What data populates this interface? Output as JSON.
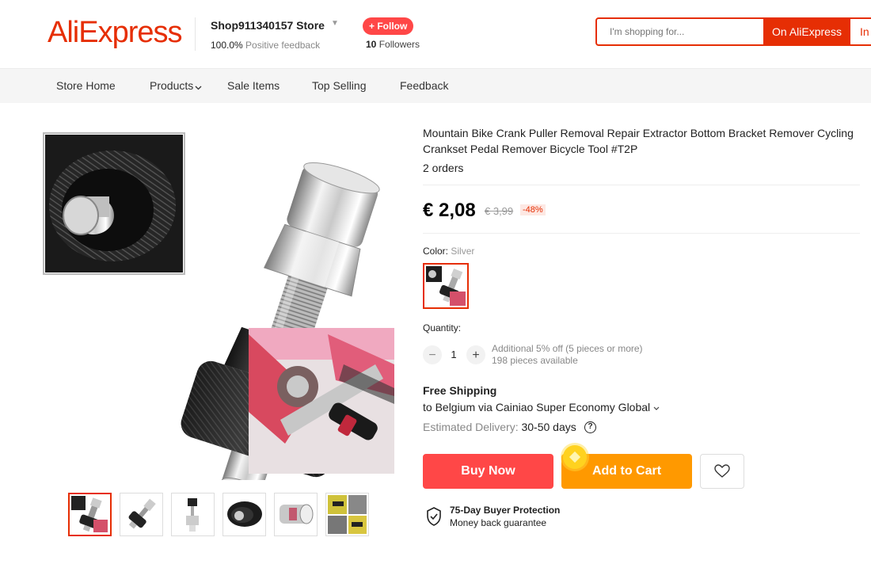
{
  "header": {
    "logo_text": "AliExpress",
    "store_name": "Shop911340157 Store",
    "feedback_percent": "100.0%",
    "feedback_label": "Positive feedback",
    "follow_label": "+ Follow",
    "followers_count": "10",
    "followers_label": "Followers",
    "search_placeholder": "I'm shopping for...",
    "search_button": "On AliExpress",
    "search_button2": "In"
  },
  "nav": {
    "items": [
      "Store Home",
      "Products",
      "Sale Items",
      "Top Selling",
      "Feedback"
    ]
  },
  "gallery": {
    "main_image_icon": "crank-puller-tool-image",
    "thumbnails": [
      "thumb-1",
      "thumb-2",
      "thumb-3",
      "thumb-4",
      "thumb-5",
      "thumb-6"
    ]
  },
  "product": {
    "title": "Mountain Bike Crank Puller Removal Repair Extractor Bottom Bracket Remover Cycling Crankset Pedal Remover Bicycle Tool #T2P",
    "orders": "2 orders",
    "price": "€ 2,08",
    "original_price": "€ 3,99",
    "discount": "-48%",
    "color_label": "Color:",
    "color_value": "Silver",
    "quantity_label": "Quantity:",
    "quantity_value": "1",
    "minus": "−",
    "plus": "+",
    "qty_note_1": "Additional 5% off (5 pieces or more)",
    "qty_note_2": "198 pieces available",
    "shipping_title": "Free Shipping",
    "shipping_line": "to Belgium via Cainiao Super Economy Global",
    "delivery_label": "Estimated Delivery:",
    "delivery_value": "30-50 days",
    "help": "?",
    "buy_now": "Buy Now",
    "add_to_cart": "Add to Cart",
    "protection_title": "75-Day Buyer Protection",
    "protection_sub": "Money back guarantee"
  },
  "colors": {
    "brand": "#e62e04",
    "buy": "#ff4747",
    "cart": "#ff9900"
  }
}
